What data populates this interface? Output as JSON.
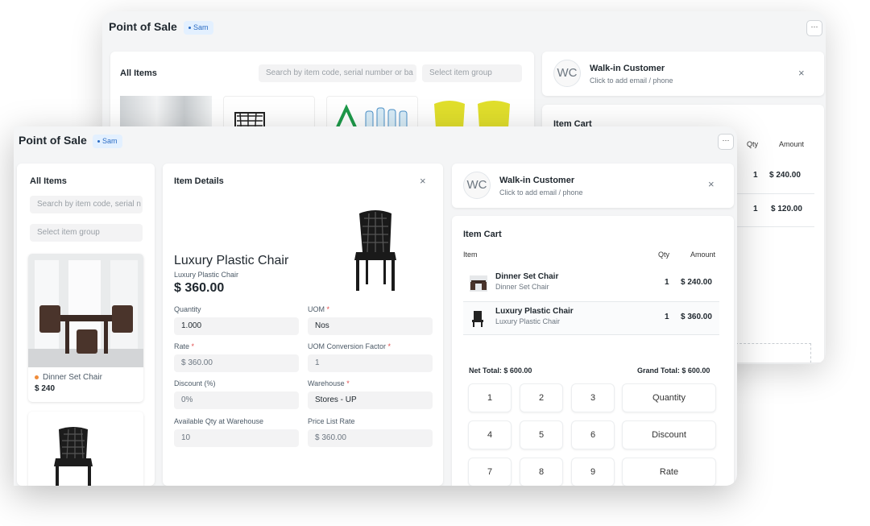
{
  "app": {
    "title": "Point of Sale",
    "user_badge": "Sam",
    "more": "···"
  },
  "items_panel": {
    "heading": "All Items",
    "search_placeholder_back": "Search by item code, serial number or ba",
    "search_placeholder_front": "Search by item code, serial n",
    "group_placeholder": "Select item group",
    "items": [
      {
        "name": "Dinner Set Chair",
        "price": "$ 240"
      }
    ]
  },
  "item_details": {
    "heading": "Item Details",
    "close": "×",
    "name": "Luxury Plastic Chair",
    "subtitle": "Luxury Plastic Chair",
    "price": "$ 360.00",
    "fields": {
      "quantity": {
        "label": "Quantity",
        "value": "1.000"
      },
      "uom": {
        "label": "UOM",
        "value": "Nos"
      },
      "rate": {
        "label": "Rate",
        "value": "$ 360.00"
      },
      "uom_factor": {
        "label": "UOM Conversion Factor",
        "value": "1"
      },
      "discount": {
        "label": "Discount (%)",
        "value": "0%"
      },
      "warehouse": {
        "label": "Warehouse",
        "value": "Stores - UP"
      },
      "available_qty": {
        "label": "Available Qty at Warehouse",
        "value": "10"
      },
      "price_list_rate": {
        "label": "Price List Rate",
        "value": "$ 360.00"
      }
    }
  },
  "customer": {
    "initials": "WC",
    "name": "Walk-in Customer",
    "hint": "Click to add email / phone",
    "close": "×"
  },
  "cart": {
    "heading": "Item Cart",
    "col_item": "Item",
    "col_qty": "Qty",
    "col_amount": "Amount",
    "rows": [
      {
        "name": "Dinner Set Chair",
        "sub": "Dinner Set Chair",
        "qty": "1",
        "amount": "$ 240.00"
      },
      {
        "name": "Luxury Plastic Chair",
        "sub": "Luxury Plastic Chair",
        "qty": "1",
        "amount": "$ 360.00"
      }
    ],
    "back_rows": [
      {
        "qty": "1",
        "amount": "$ 240.00"
      },
      {
        "qty": "1",
        "amount": "$ 120.00"
      }
    ],
    "net_total": "Net Total: $ 600.00",
    "grand_total": "Grand Total: $ 600.00"
  },
  "numpad": {
    "keys": [
      "1",
      "2",
      "3",
      "4",
      "5",
      "6",
      "7",
      "8",
      "9"
    ],
    "modes": [
      "Quantity",
      "Discount",
      "Rate"
    ]
  },
  "colors": {
    "accent_badge": "#e3f0ff",
    "indicator": "#f08c3a",
    "required": "#e24c4c"
  }
}
